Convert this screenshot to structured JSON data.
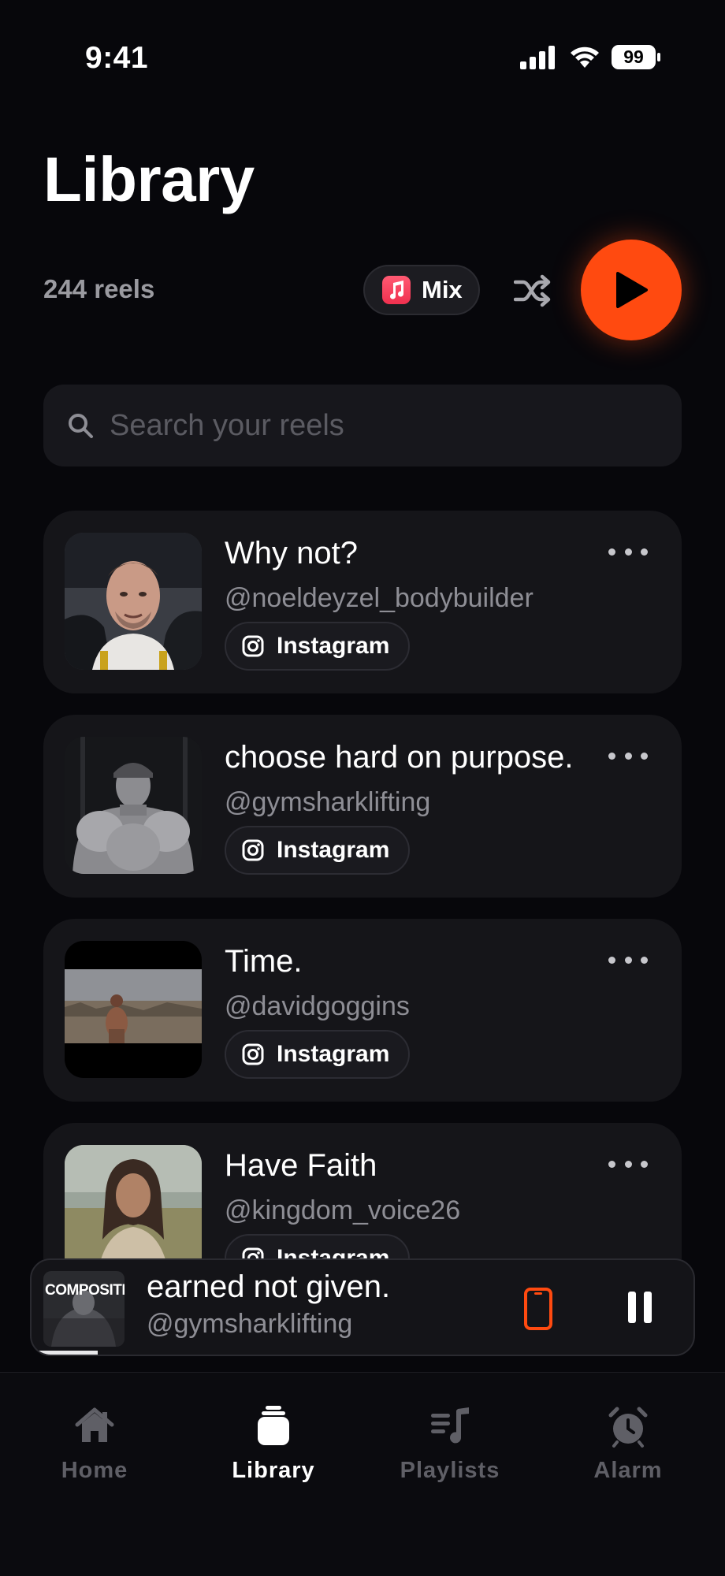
{
  "status_bar": {
    "time": "9:41",
    "battery": "99"
  },
  "header": {
    "title": "Library"
  },
  "controls": {
    "reel_count": "244 reels",
    "mix_label": "Mix",
    "accent_color": "#ff4a10"
  },
  "search": {
    "placeholder": "Search your reels",
    "value": ""
  },
  "reels": [
    {
      "title": "Why not?",
      "handle": "@noeldeyzel_bodybuilder",
      "source": "Instagram",
      "thumb_icon": "portrait-thumbnail"
    },
    {
      "title": "choose hard on purpose.",
      "handle": "@gymsharklifting",
      "source": "Instagram",
      "thumb_icon": "bodybuilder-thumbnail"
    },
    {
      "title": "Time.",
      "handle": "@davidgoggins",
      "source": "Instagram",
      "thumb_icon": "runner-thumbnail"
    },
    {
      "title": "Have Faith",
      "handle": "@kingdom_voice26",
      "source": "Instagram",
      "thumb_icon": "figure-thumbnail"
    }
  ],
  "now_playing": {
    "title": "earned not given.",
    "handle": "@gymsharklifting",
    "thumb_text": "COMPOSITIO",
    "progress": 0.1
  },
  "tabs": [
    {
      "label": "Home",
      "icon": "home-icon",
      "active": false
    },
    {
      "label": "Library",
      "icon": "library-icon",
      "active": true
    },
    {
      "label": "Playlists",
      "icon": "playlists-icon",
      "active": false
    },
    {
      "label": "Alarm",
      "icon": "alarm-icon",
      "active": false
    }
  ]
}
